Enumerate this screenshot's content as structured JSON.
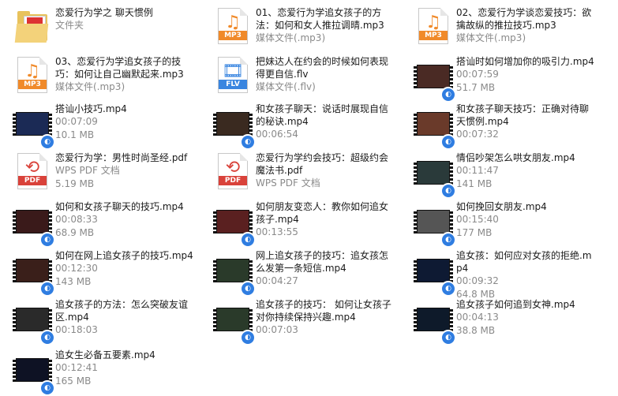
{
  "items": [
    {
      "kind": "folder",
      "name": "恋爱行为学之 聊天惯例",
      "meta1": "文件夹",
      "meta2": ""
    },
    {
      "kind": "mp3",
      "name": "01、恋爱行为学追女孩子的方法：如何和女人推拉调晴.mp3",
      "meta1": "媒体文件(.mp3)",
      "meta2": "",
      "label": "MP3"
    },
    {
      "kind": "mp3",
      "name": "02、恋爱行为学谈恋爱技巧：欲擒故纵的推拉技巧.mp3",
      "meta1": "媒体文件(.mp3)",
      "meta2": "",
      "label": "MP3"
    },
    {
      "kind": "mp3",
      "name": "03、恋爱行为学追女孩子的技巧：如何让自己幽默起来.mp3",
      "meta1": "媒体文件(.mp3)",
      "meta2": "",
      "label": "MP3"
    },
    {
      "kind": "flv",
      "name": "把妹达人在约会的时候如何表现得更自信.flv",
      "meta1": "媒体文件(.flv)",
      "meta2": "",
      "label": "FLV"
    },
    {
      "kind": "video",
      "name": "搭讪时如何增加你的吸引力.mp4",
      "meta1": "00:07:59",
      "meta2": "51.7 MB",
      "scene": "#4a2a24"
    },
    {
      "kind": "video",
      "name": "搭讪小技巧.mp4",
      "meta1": "00:07:09",
      "meta2": "10.1 MB",
      "scene": "#1b2a55"
    },
    {
      "kind": "video",
      "name": "和女孩子聊天：说话时展现自信的秘诀.mp4",
      "meta1": "00:06:54",
      "meta2": "",
      "scene": "#3a2a20"
    },
    {
      "kind": "video",
      "name": "和女孩子聊天技巧：正确对待聊天惯例.mp4",
      "meta1": "00:07:32",
      "meta2": "",
      "scene": "#6a3a2a"
    },
    {
      "kind": "pdf",
      "name": "恋爱行为学：男性时尚圣经.pdf",
      "meta1": "WPS PDF 文档",
      "meta2": "5.19 MB",
      "label": "PDF"
    },
    {
      "kind": "pdf",
      "name": "恋爱行为学约会技巧：超级约会魔法书.pdf",
      "meta1": "WPS PDF 文档",
      "meta2": "",
      "label": "PDF"
    },
    {
      "kind": "video",
      "name": "情侣吵架怎么哄女朋友.mp4",
      "meta1": "00:11:47",
      "meta2": "141 MB",
      "scene": "#2a3a3a"
    },
    {
      "kind": "video",
      "name": "如何和女孩子聊天的技巧.mp4",
      "meta1": "00:08:33",
      "meta2": "68.9 MB",
      "scene": "#3a1a1a"
    },
    {
      "kind": "video",
      "name": "如何朋友变恋人：教你如何追女孩子.mp4",
      "meta1": "00:13:55",
      "meta2": "",
      "scene": "#5a2020"
    },
    {
      "kind": "video",
      "name": "如何挽回女朋友.mp4",
      "meta1": "00:15:40",
      "meta2": "177 MB",
      "scene": "#555555"
    },
    {
      "kind": "video",
      "name": "如何在网上追女孩子的技巧.mp4",
      "meta1": "00:12:30",
      "meta2": "143 MB",
      "scene": "#3a1f1a"
    },
    {
      "kind": "video",
      "name": "网上追女孩子的技巧：追女孩怎么发第一条短信.mp4",
      "meta1": "00:04:27",
      "meta2": "",
      "scene": "#2a3a2a"
    },
    {
      "kind": "video",
      "name": "追女孩：如何应对女孩的拒绝.mp4",
      "meta1": "00:09:32",
      "meta2": "64.8 MB",
      "scene": "#0e1a33"
    },
    {
      "kind": "video",
      "name": "追女孩子的方法：怎么突破友谊区.mp4",
      "meta1": "00:18:03",
      "meta2": "",
      "scene": "#2a2a2a"
    },
    {
      "kind": "video",
      "name": "追女孩子的技巧： 如何让女孩子对你持续保持兴趣.mp4",
      "meta1": "00:07:03",
      "meta2": "",
      "scene": "#2a3a2a"
    },
    {
      "kind": "video",
      "name": "追女孩子如何追到女神.mp4",
      "meta1": "00:04:13",
      "meta2": "38.8 MB",
      "scene": "#0e1a2a"
    },
    {
      "kind": "video",
      "name": "追女生必备五要素.mp4",
      "meta1": "00:12:41",
      "meta2": "165 MB",
      "scene": "#0e1224"
    }
  ],
  "colors": {
    "mp3": "#f08a2a",
    "flv": "#3a86e0",
    "pdf": "#d9423a"
  }
}
